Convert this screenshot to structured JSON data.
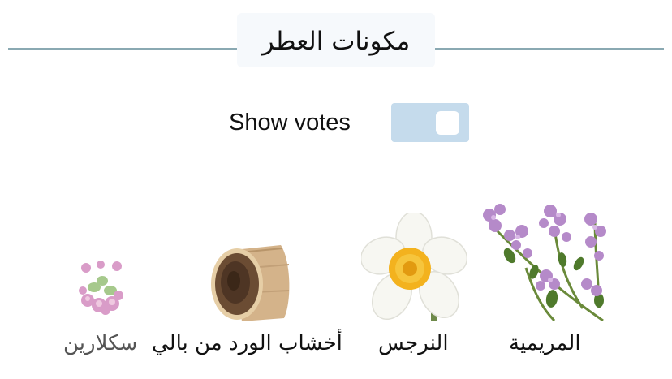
{
  "section": {
    "title": "مكونات العطر"
  },
  "votes_toggle": {
    "label": "Show votes",
    "state": "off"
  },
  "ingredients": [
    {
      "name": "المريمية",
      "icon": "thyme-flower-image"
    },
    {
      "name": "النرجس",
      "icon": "narcissus-flower-image"
    },
    {
      "name": "أخشاب الورد من بالي",
      "icon": "rosewood-log-image"
    },
    {
      "name": "سكلارين",
      "icon": "sclarene-flower-image"
    }
  ],
  "colors": {
    "divider": "#8aa9b2",
    "toggle_bg": "#c5dbec",
    "title_bg": "#f6f9fc"
  }
}
